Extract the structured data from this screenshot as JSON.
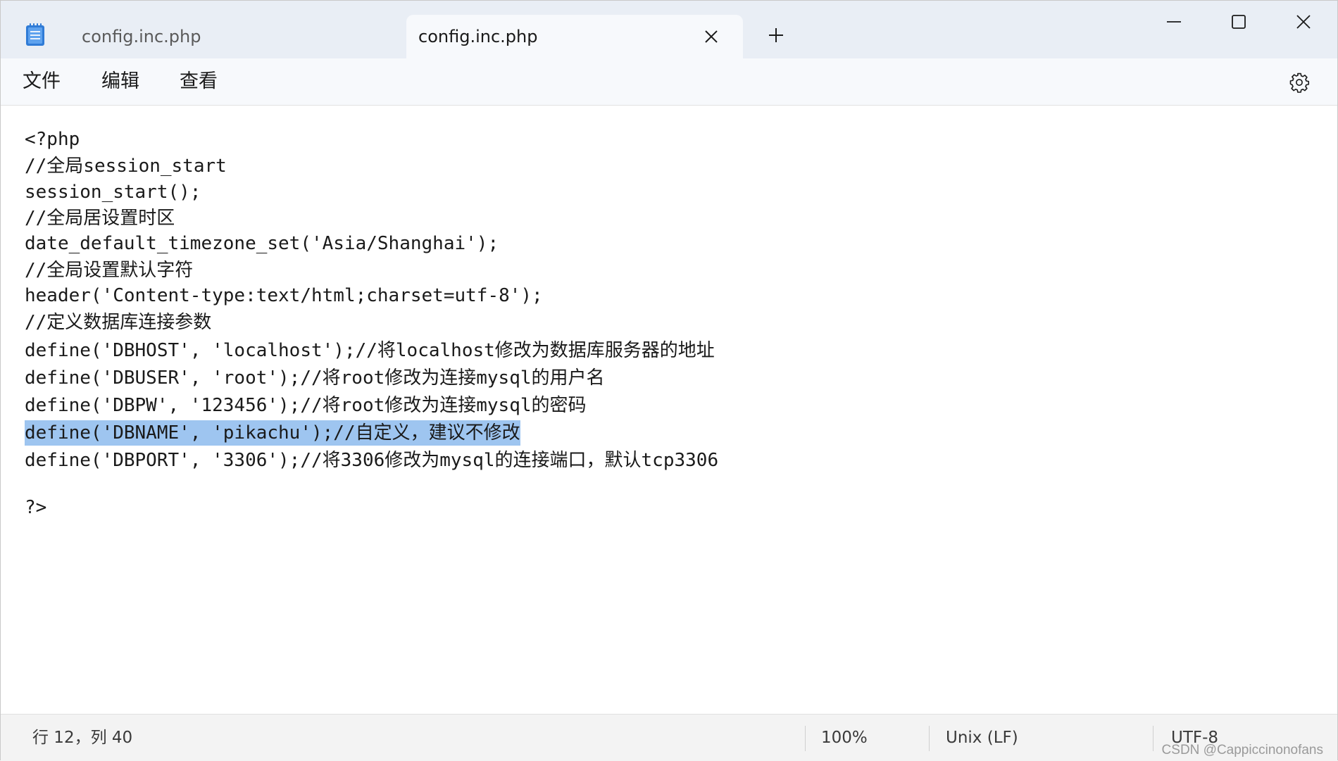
{
  "tabs": [
    {
      "title": "config.inc.php",
      "active": false
    },
    {
      "title": "config.inc.php",
      "active": true
    }
  ],
  "menu": [
    "文件",
    "编辑",
    "查看"
  ],
  "editor": {
    "lines": [
      "<?php",
      "//全局session_start",
      "session_start();",
      "//全局居设置时区",
      "date_default_timezone_set('Asia/Shanghai');",
      "//全局设置默认字符",
      "header('Content-type:text/html;charset=utf-8');",
      "//定义数据库连接参数",
      "define('DBHOST', 'localhost');//将localhost修改为数据库服务器的地址",
      "define('DBUSER', 'root');//将root修改为连接mysql的用户名",
      "define('DBPW', '123456');//将root修改为连接mysql的密码",
      "define('DBNAME', 'pikachu');//自定义，建议不修改",
      "define('DBPORT', '3306');//将3306修改为mysql的连接端口，默认tcp3306",
      "",
      "?>"
    ],
    "selected_line": 12
  },
  "status": {
    "position": "行 12，列 40",
    "zoom": "100%",
    "line_ending": "Unix (LF)",
    "encoding": "UTF-8"
  },
  "watermark": "CSDN @Cappiccinonofans",
  "icons": {
    "app": "notepad-icon",
    "close": "close-icon",
    "add": "plus-icon",
    "minimize": "minimize-icon",
    "maximize": "maximize-icon",
    "window_close": "window-close-icon",
    "settings": "gear-icon"
  },
  "colors": {
    "selection": "#9ec5f0",
    "titlebar": "#e9eef5",
    "app_icon": "#2f7bd6"
  }
}
